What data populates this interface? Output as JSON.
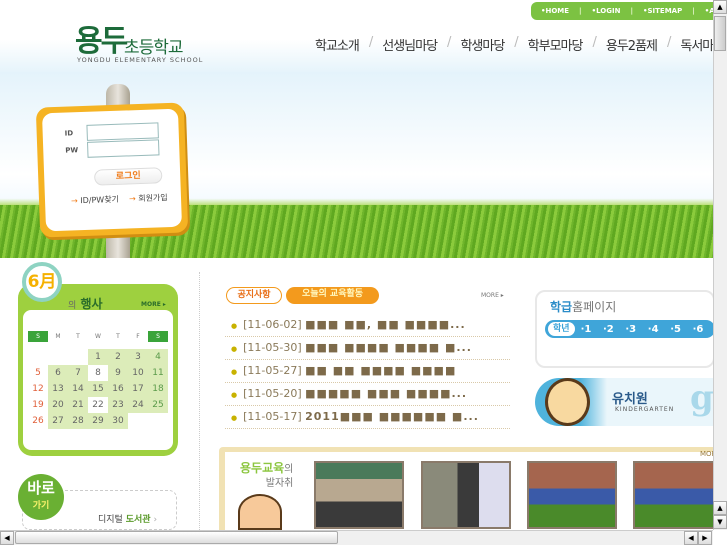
{
  "topbar": {
    "links": [
      "HOME",
      "LOGIN",
      "SITEMAP",
      "ADMIN"
    ]
  },
  "logo": {
    "main": "용두",
    "sub": "초등학교",
    "en": "YONGDU ELEMENTARY SCHOOL"
  },
  "nav": [
    "학교소개",
    "선생님마당",
    "학생마당",
    "학부모마당",
    "용두2품제",
    "독서마당"
  ],
  "login": {
    "id_label": "ID",
    "pw_label": "PW",
    "button": "로그인",
    "find": "ID/PW찾기",
    "join": "회원가입",
    "arrow": "→"
  },
  "calendar": {
    "month_badge": "6月",
    "title_prefix": "의",
    "title": "행사",
    "more": "MORE ▸",
    "weekdays": [
      "S",
      "M",
      "T",
      "W",
      "T",
      "F",
      "S"
    ],
    "days": [
      "",
      "",
      "",
      "1",
      "2",
      "3",
      "4",
      "5",
      "6",
      "7",
      "8",
      "9",
      "10",
      "11",
      "12",
      "13",
      "14",
      "15",
      "16",
      "17",
      "18",
      "19",
      "20",
      "21",
      "22",
      "23",
      "24",
      "25",
      "26",
      "27",
      "28",
      "29",
      "30"
    ]
  },
  "quick": {
    "badge": "바로",
    "badge_sub": "가기",
    "label_a": "디지털",
    "label_b": "도서관",
    "arrow": "›"
  },
  "notice": {
    "tabs": [
      "공지사항",
      "오늘의 교육활동"
    ],
    "more": "MORE ▸",
    "bullet": "●",
    "items": [
      {
        "date": "[11-06-02]",
        "title": "■■■ ■■, ■■ ■■■■..."
      },
      {
        "date": "[11-05-30]",
        "title": "■■■ ■■■■ ■■■■ ■..."
      },
      {
        "date": "[11-05-27]",
        "title": "■■ ■■ ■■■■ ■■■■"
      },
      {
        "date": "[11-05-20]",
        "title": "■■■■■ ■■■ ■■■■..."
      },
      {
        "date": "[11-05-17]",
        "title": "2011■■■ ■■■■■■ ■..."
      }
    ]
  },
  "class_home": {
    "title_a": "학급",
    "title_b": "홈페이지",
    "grade_label": "학년",
    "grades": [
      "·1",
      "·2",
      "·3",
      "·4",
      "·5",
      "·6"
    ]
  },
  "kindergarten": {
    "title": "유치원",
    "sub": "KINDERGARTEN",
    "deco": "go"
  },
  "gallery": {
    "title_a": "용두교육",
    "title_b": "의",
    "title_c": "발자취",
    "more": "MORE"
  },
  "scroll": {
    "up": "▲",
    "down": "▼",
    "left": "◀",
    "right": "▶"
  }
}
